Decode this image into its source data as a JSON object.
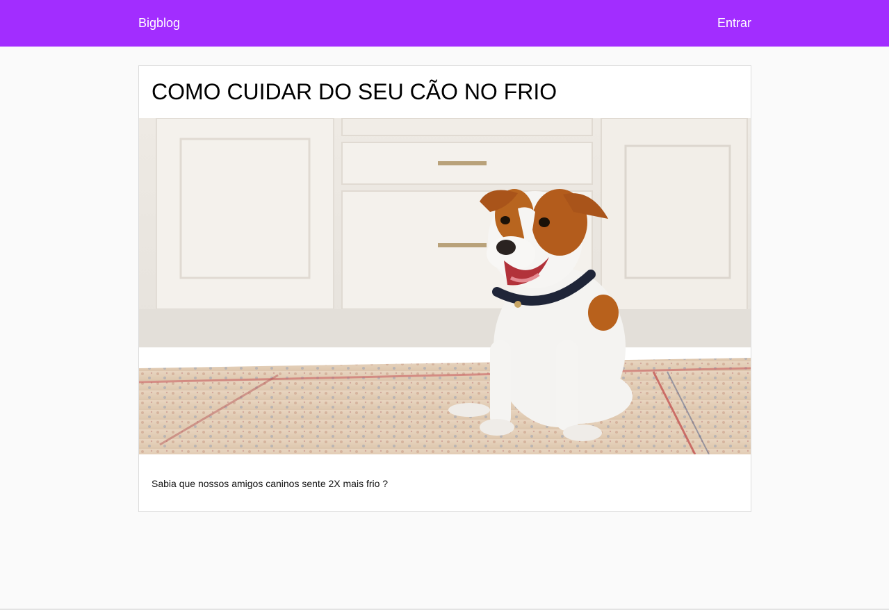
{
  "nav": {
    "brand": "Bigblog",
    "login": "Entrar"
  },
  "post": {
    "title": "COMO CUIDAR DO SEU CÃO NO FRIO",
    "excerpt": "Sabia que nossos amigos caninos sente 2X mais frio ?",
    "image_alt": "Cão Jack Russell sentado sobre um tapete"
  },
  "colors": {
    "navbar": "#a22dff",
    "background": "#fafafa"
  }
}
